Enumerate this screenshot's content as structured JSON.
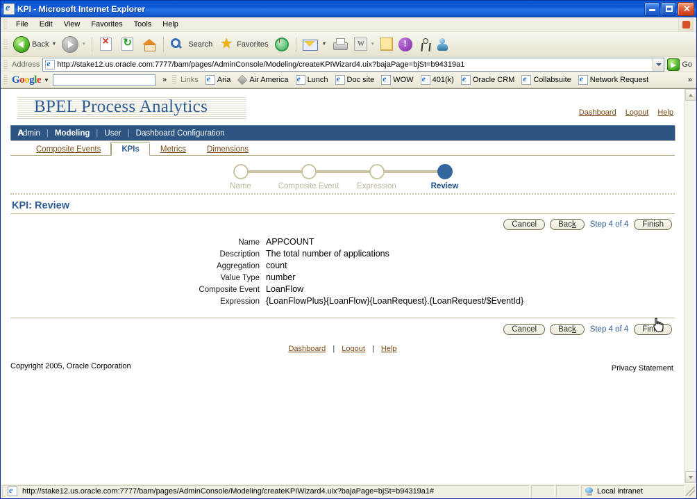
{
  "window": {
    "title": "KPI - Microsoft Internet Explorer",
    "app_icon": "ie-document-icon",
    "minimize_label": "Minimize",
    "maximize_label": "Maximize",
    "close_label": "Close"
  },
  "menubar": {
    "items": [
      {
        "label": "File"
      },
      {
        "label": "Edit"
      },
      {
        "label": "View"
      },
      {
        "label": "Favorites"
      },
      {
        "label": "Tools"
      },
      {
        "label": "Help"
      }
    ]
  },
  "toolbar": {
    "back_label": "Back",
    "search_label": "Search",
    "favorites_label": "Favorites",
    "icons": [
      "back-icon",
      "forward-icon",
      "stop-icon",
      "refresh-icon",
      "home-icon",
      "search-icon",
      "favorites-icon",
      "history-icon",
      "mail-icon",
      "print-icon",
      "edit-word-icon",
      "notes-icon",
      "yahoo-messenger-icon",
      "walker-icon",
      "messenger-icon"
    ]
  },
  "address_bar": {
    "label": "Address",
    "url": "http://stake12.us.oracle.com:7777/bam/pages/AdminConsole/Modeling/createKPIWizard4.uix?bajaPage=bjSt=b94319a1",
    "go_label": "Go"
  },
  "google_bar": {
    "logo": "Google",
    "search_value": "",
    "overflow": "»"
  },
  "links_bar": {
    "label": "Links",
    "items": [
      {
        "label": "Aria",
        "icon": "ie-page-icon"
      },
      {
        "label": "Air America",
        "icon": "diamond-icon"
      },
      {
        "label": "Lunch",
        "icon": "ie-page-icon"
      },
      {
        "label": "Doc site",
        "icon": "ie-page-icon"
      },
      {
        "label": "WOW",
        "icon": "ie-page-icon"
      },
      {
        "label": "401(k)",
        "icon": "ie-page-icon"
      },
      {
        "label": "Oracle CRM",
        "icon": "ie-page-icon"
      },
      {
        "label": "Collabsuite",
        "icon": "ie-page-icon"
      },
      {
        "label": "Network Request",
        "icon": "ie-page-icon"
      }
    ],
    "overflow": "»"
  },
  "branding": {
    "title": "BPEL Process Analytics",
    "links": [
      {
        "label": "Dashboard"
      },
      {
        "label": "Logout"
      },
      {
        "label": "Help"
      }
    ]
  },
  "nav": {
    "items": [
      {
        "label": "Admin",
        "selected": false
      },
      {
        "label": "Modeling",
        "selected": true
      },
      {
        "label": "User",
        "selected": false
      },
      {
        "label": "Dashboard Configuration",
        "selected": false
      }
    ],
    "separator": "|"
  },
  "tabs": [
    {
      "label": "Composite Events",
      "selected": false
    },
    {
      "label": "KPIs",
      "selected": true
    },
    {
      "label": "Metrics",
      "selected": false
    },
    {
      "label": "Dimensions",
      "selected": false
    }
  ],
  "train": {
    "steps": [
      {
        "label": "Name",
        "active": false
      },
      {
        "label": "Composite Event",
        "active": false
      },
      {
        "label": "Expression",
        "active": false
      },
      {
        "label": "Review",
        "active": true
      }
    ]
  },
  "content": {
    "page_title": "KPI: Review",
    "buttons": {
      "cancel": "Cancel",
      "back": "Back",
      "back_accesskey": "k",
      "finish": "Finish",
      "step_info": "Step 4 of 4"
    },
    "fields": [
      {
        "label": "Name",
        "value": "APPCOUNT"
      },
      {
        "label": "Description",
        "value": "The total number of applications"
      },
      {
        "label": "Aggregation",
        "value": "count"
      },
      {
        "label": "Value Type",
        "value": "number"
      },
      {
        "label": "Composite Event",
        "value": "LoanFlow"
      },
      {
        "label": "Expression",
        "value": "{LoanFlowPlus}{LoanFlow}{LoanRequest}.{LoanRequest/$EventId}"
      }
    ]
  },
  "footer": {
    "links": [
      {
        "label": "Dashboard"
      },
      {
        "label": "Logout"
      },
      {
        "label": "Help"
      }
    ],
    "separator": "|",
    "copyright": "Copyright 2005, Oracle Corporation",
    "privacy": "Privacy Statement"
  },
  "status_bar": {
    "url": "http://stake12.us.oracle.com:7777/bam/pages/AdminConsole/Modeling/createKPIWizard4.uix?bajaPage=bjSt=b94319a1#",
    "zone": "Local intranet",
    "zone_icon": "intranet-globe-icon"
  },
  "colors": {
    "title_bar": "#0a54d0",
    "nav_bar": "#2c5584",
    "brand_text": "#2b5c94",
    "link": "#7a4a14",
    "accent_blue": "#34669e",
    "train_inactive": "#c9c3a0"
  }
}
